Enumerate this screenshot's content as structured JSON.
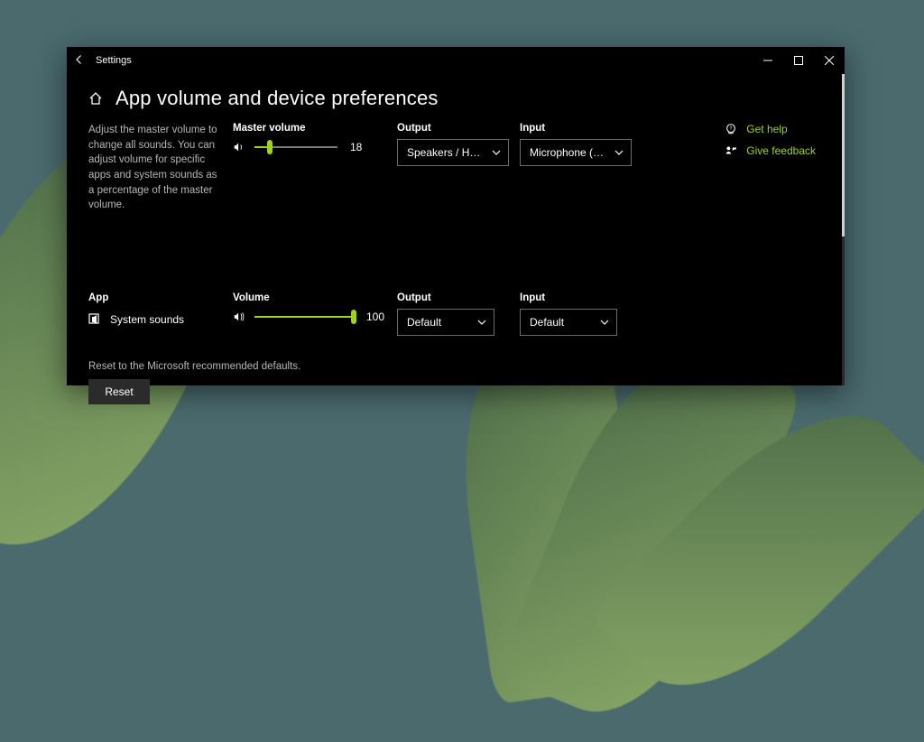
{
  "window": {
    "title": "Settings"
  },
  "page": {
    "heading": "App volume and device preferences",
    "description": "Adjust the master volume to change all sounds. You can adjust volume for specific apps and system sounds as a percentage of the master volume.",
    "reset_note": "Reset to the Microsoft recommended defaults.",
    "reset_button": "Reset"
  },
  "labels": {
    "master_volume": "Master volume",
    "output": "Output",
    "input": "Input",
    "app": "App",
    "volume": "Volume"
  },
  "master": {
    "value": 18,
    "output_selected": "Speakers / Headpho…",
    "input_selected": "Microphone (Realte…"
  },
  "apps": [
    {
      "name": "System sounds",
      "volume": 100,
      "output": "Default",
      "input": "Default"
    }
  ],
  "actions": {
    "get_help": "Get help",
    "give_feedback": "Give feedback"
  },
  "colors": {
    "accent": "#9fd41a",
    "bg_window": "#000000",
    "text_secondary": "#b7b7b7"
  }
}
